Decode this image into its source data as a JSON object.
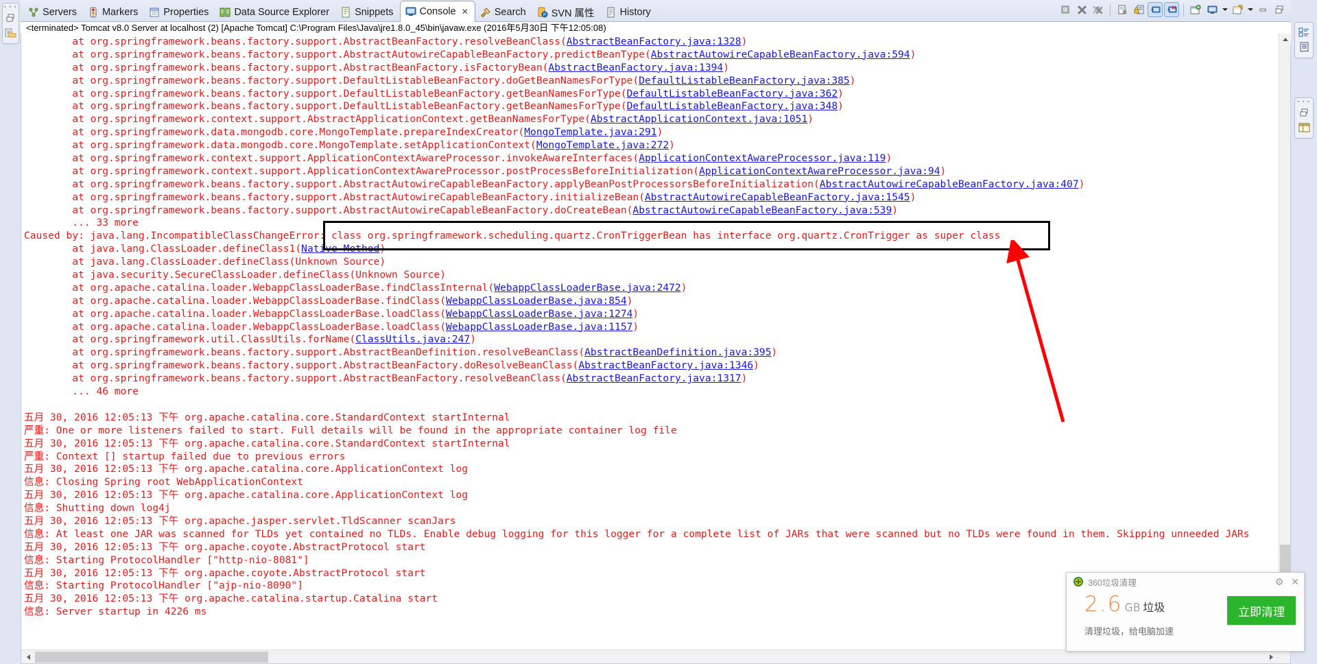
{
  "window": {
    "console_title": "<terminated> Tomcat v8.0 Server at localhost (2) [Apache Tomcat] C:\\Program Files\\Java\\jre1.8.0_45\\bin\\javaw.exe (2016年5月30日 下午12:05:08)"
  },
  "tabs": [
    {
      "label": "Servers",
      "icon": "servers-icon",
      "active": false
    },
    {
      "label": "Markers",
      "icon": "markers-icon",
      "active": false
    },
    {
      "label": "Properties",
      "icon": "properties-icon",
      "active": false
    },
    {
      "label": "Data Source Explorer",
      "icon": "data-source-explorer-icon",
      "active": false
    },
    {
      "label": "Snippets",
      "icon": "snippets-icon",
      "active": false
    },
    {
      "label": "Console",
      "icon": "console-icon",
      "active": true,
      "close": "✕"
    },
    {
      "label": "Search",
      "icon": "search-icon",
      "active": false
    },
    {
      "label": "SVN 属性",
      "icon": "svn-icon",
      "active": false
    },
    {
      "label": "History",
      "icon": "history-icon",
      "active": false
    }
  ],
  "toolbar": {
    "buttons": [
      {
        "name": "terminate-button",
        "icon": "stop-square-icon",
        "pressed": false
      },
      {
        "name": "remove-launch-button",
        "icon": "x-gray-icon",
        "pressed": false
      },
      {
        "name": "remove-all-terminated-button",
        "icon": "xx-gray-icon",
        "pressed": false
      },
      {
        "name": "clear-console-button",
        "icon": "clear-console-icon",
        "pressed": false
      },
      {
        "name": "scroll-lock-button",
        "icon": "scroll-lock-icon",
        "pressed": false
      },
      {
        "name": "show-console-on-output-button",
        "icon": "console-out-icon",
        "pressed": true
      },
      {
        "name": "show-console-on-error-button",
        "icon": "console-err-icon",
        "pressed": true
      },
      {
        "name": "pin-console-button",
        "icon": "pin-console-icon",
        "pressed": false
      },
      {
        "name": "display-selected-console-button",
        "icon": "display-console-icon",
        "pressed": false
      },
      {
        "name": "open-console-button",
        "icon": "open-console-icon",
        "pressed": false
      },
      {
        "name": "minimize-button",
        "icon": "minimize-icon",
        "pressed": false
      },
      {
        "name": "maximize-button",
        "icon": "maximize-icon",
        "pressed": false
      }
    ]
  },
  "left_rail": {
    "icons": [
      "restore-icon",
      "project-explorer-icon"
    ]
  },
  "right_rail": {
    "group1": [
      "outline-icon",
      "document-outline-icon"
    ],
    "group2": [
      "restore-icon",
      "layout-icon"
    ]
  },
  "console_lines": [
    {
      "indent": 8,
      "segments": [
        {
          "t": "at org.springframework.beans.factory.support.AbstractBeanFactory.resolveBeanClass("
        },
        {
          "t": "AbstractBeanFactory.java:1328",
          "link": true
        },
        {
          "t": ")"
        }
      ]
    },
    {
      "indent": 8,
      "segments": [
        {
          "t": "at org.springframework.beans.factory.support.AbstractAutowireCapableBeanFactory.predictBeanType("
        },
        {
          "t": "AbstractAutowireCapableBeanFactory.java:594",
          "link": true
        },
        {
          "t": ")"
        }
      ]
    },
    {
      "indent": 8,
      "segments": [
        {
          "t": "at org.springframework.beans.factory.support.AbstractBeanFactory.isFactoryBean("
        },
        {
          "t": "AbstractBeanFactory.java:1394",
          "link": true
        },
        {
          "t": ")"
        }
      ]
    },
    {
      "indent": 8,
      "segments": [
        {
          "t": "at org.springframework.beans.factory.support.DefaultListableBeanFactory.doGetBeanNamesForType("
        },
        {
          "t": "DefaultListableBeanFactory.java:385",
          "link": true
        },
        {
          "t": ")"
        }
      ]
    },
    {
      "indent": 8,
      "segments": [
        {
          "t": "at org.springframework.beans.factory.support.DefaultListableBeanFactory.getBeanNamesForType("
        },
        {
          "t": "DefaultListableBeanFactory.java:362",
          "link": true
        },
        {
          "t": ")"
        }
      ]
    },
    {
      "indent": 8,
      "segments": [
        {
          "t": "at org.springframework.beans.factory.support.DefaultListableBeanFactory.getBeanNamesForType("
        },
        {
          "t": "DefaultListableBeanFactory.java:348",
          "link": true
        },
        {
          "t": ")"
        }
      ]
    },
    {
      "indent": 8,
      "segments": [
        {
          "t": "at org.springframework.context.support.AbstractApplicationContext.getBeanNamesForType("
        },
        {
          "t": "AbstractApplicationContext.java:1051",
          "link": true
        },
        {
          "t": ")"
        }
      ]
    },
    {
      "indent": 8,
      "segments": [
        {
          "t": "at org.springframework.data.mongodb.core.MongoTemplate.prepareIndexCreator("
        },
        {
          "t": "MongoTemplate.java:291",
          "link": true
        },
        {
          "t": ")"
        }
      ]
    },
    {
      "indent": 8,
      "segments": [
        {
          "t": "at org.springframework.data.mongodb.core.MongoTemplate.setApplicationContext("
        },
        {
          "t": "MongoTemplate.java:272",
          "link": true
        },
        {
          "t": ")"
        }
      ]
    },
    {
      "indent": 8,
      "segments": [
        {
          "t": "at org.springframework.context.support.ApplicationContextAwareProcessor.invokeAwareInterfaces("
        },
        {
          "t": "ApplicationContextAwareProcessor.java:119",
          "link": true
        },
        {
          "t": ")"
        }
      ]
    },
    {
      "indent": 8,
      "segments": [
        {
          "t": "at org.springframework.context.support.ApplicationContextAwareProcessor.postProcessBeforeInitialization("
        },
        {
          "t": "ApplicationContextAwareProcessor.java:94",
          "link": true
        },
        {
          "t": ")"
        }
      ]
    },
    {
      "indent": 8,
      "segments": [
        {
          "t": "at org.springframework.beans.factory.support.AbstractAutowireCapableBeanFactory.applyBeanPostProcessorsBeforeInitialization("
        },
        {
          "t": "AbstractAutowireCapableBeanFactory.java:407",
          "link": true
        },
        {
          "t": ")"
        }
      ]
    },
    {
      "indent": 8,
      "segments": [
        {
          "t": "at org.springframework.beans.factory.support.AbstractAutowireCapableBeanFactory.initializeBean("
        },
        {
          "t": "AbstractAutowireCapableBeanFactory.java:1545",
          "link": true
        },
        {
          "t": ")"
        }
      ]
    },
    {
      "indent": 8,
      "segments": [
        {
          "t": "at org.springframework.beans.factory.support.AbstractAutowireCapableBeanFactory.doCreateBean("
        },
        {
          "t": "AbstractAutowireCapableBeanFactory.java:539",
          "link": true
        },
        {
          "t": ")"
        }
      ]
    },
    {
      "indent": 8,
      "segments": [
        {
          "t": "... 33 more"
        }
      ]
    },
    {
      "indent": 0,
      "segments": [
        {
          "t": "Caused by: java.lang.IncompatibleClassChangeError: class org.springframework.scheduling.quartz.CronTriggerBean has interface org.quartz.CronTrigger as super class"
        }
      ]
    },
    {
      "indent": 8,
      "segments": [
        {
          "t": "at java.lang.ClassLoader.defineClass1("
        },
        {
          "t": "Native Method",
          "link": true
        },
        {
          "t": ")"
        }
      ]
    },
    {
      "indent": 8,
      "segments": [
        {
          "t": "at java.lang.ClassLoader.defineClass(Unknown Source)"
        }
      ]
    },
    {
      "indent": 8,
      "segments": [
        {
          "t": "at java.security.SecureClassLoader.defineClass(Unknown Source)"
        }
      ]
    },
    {
      "indent": 8,
      "segments": [
        {
          "t": "at org.apache.catalina.loader.WebappClassLoaderBase.findClassInternal("
        },
        {
          "t": "WebappClassLoaderBase.java:2472",
          "link": true
        },
        {
          "t": ")"
        }
      ]
    },
    {
      "indent": 8,
      "segments": [
        {
          "t": "at org.apache.catalina.loader.WebappClassLoaderBase.findClass("
        },
        {
          "t": "WebappClassLoaderBase.java:854",
          "link": true
        },
        {
          "t": ")"
        }
      ]
    },
    {
      "indent": 8,
      "segments": [
        {
          "t": "at org.apache.catalina.loader.WebappClassLoaderBase.loadClass("
        },
        {
          "t": "WebappClassLoaderBase.java:1274",
          "link": true
        },
        {
          "t": ")"
        }
      ]
    },
    {
      "indent": 8,
      "segments": [
        {
          "t": "at org.apache.catalina.loader.WebappClassLoaderBase.loadClass("
        },
        {
          "t": "WebappClassLoaderBase.java:1157",
          "link": true
        },
        {
          "t": ")"
        }
      ]
    },
    {
      "indent": 8,
      "segments": [
        {
          "t": "at org.springframework.util.ClassUtils.forName("
        },
        {
          "t": "ClassUtils.java:247",
          "link": true
        },
        {
          "t": ")"
        }
      ]
    },
    {
      "indent": 8,
      "segments": [
        {
          "t": "at org.springframework.beans.factory.support.AbstractBeanDefinition.resolveBeanClass("
        },
        {
          "t": "AbstractBeanDefinition.java:395",
          "link": true
        },
        {
          "t": ")"
        }
      ]
    },
    {
      "indent": 8,
      "segments": [
        {
          "t": "at org.springframework.beans.factory.support.AbstractBeanFactory.doResolveBeanClass("
        },
        {
          "t": "AbstractBeanFactory.java:1346",
          "link": true
        },
        {
          "t": ")"
        }
      ]
    },
    {
      "indent": 8,
      "segments": [
        {
          "t": "at org.springframework.beans.factory.support.AbstractBeanFactory.resolveBeanClass("
        },
        {
          "t": "AbstractBeanFactory.java:1317",
          "link": true
        },
        {
          "t": ")"
        }
      ]
    },
    {
      "indent": 8,
      "segments": [
        {
          "t": "... 46 more"
        }
      ]
    },
    {
      "indent": 0,
      "segments": [
        {
          "t": ""
        }
      ]
    },
    {
      "indent": 0,
      "segments": [
        {
          "t": "五月 30, 2016 12:05:13 下午 org.apache.catalina.core.StandardContext startInternal"
        }
      ]
    },
    {
      "indent": 0,
      "segments": [
        {
          "t": "严重: One or more listeners failed to start. Full details will be found in the appropriate container log file"
        }
      ]
    },
    {
      "indent": 0,
      "segments": [
        {
          "t": "五月 30, 2016 12:05:13 下午 org.apache.catalina.core.StandardContext startInternal"
        }
      ]
    },
    {
      "indent": 0,
      "segments": [
        {
          "t": "严重: Context [] startup failed due to previous errors"
        }
      ]
    },
    {
      "indent": 0,
      "segments": [
        {
          "t": "五月 30, 2016 12:05:13 下午 org.apache.catalina.core.ApplicationContext log"
        }
      ]
    },
    {
      "indent": 0,
      "segments": [
        {
          "t": "信息: Closing Spring root WebApplicationContext"
        }
      ]
    },
    {
      "indent": 0,
      "segments": [
        {
          "t": "五月 30, 2016 12:05:13 下午 org.apache.catalina.core.ApplicationContext log"
        }
      ]
    },
    {
      "indent": 0,
      "segments": [
        {
          "t": "信息: Shutting down log4j"
        }
      ]
    },
    {
      "indent": 0,
      "segments": [
        {
          "t": "五月 30, 2016 12:05:13 下午 org.apache.jasper.servlet.TldScanner scanJars"
        }
      ]
    },
    {
      "indent": 0,
      "segments": [
        {
          "t": "信息: At least one JAR was scanned for TLDs yet contained no TLDs. Enable debug logging for this logger for a complete list of JARs that were scanned but no TLDs were found in them. Skipping unneeded JARs"
        }
      ]
    },
    {
      "indent": 0,
      "segments": [
        {
          "t": "五月 30, 2016 12:05:13 下午 org.apache.coyote.AbstractProtocol start"
        }
      ]
    },
    {
      "indent": 0,
      "segments": [
        {
          "t": "信息: Starting ProtocolHandler [\"http-nio-8081\"]"
        }
      ]
    },
    {
      "indent": 0,
      "segments": [
        {
          "t": "五月 30, 2016 12:05:13 下午 org.apache.coyote.AbstractProtocol start"
        }
      ]
    },
    {
      "indent": 0,
      "segments": [
        {
          "t": "信息: Starting ProtocolHandler [\"ajp-nio-8090\"]"
        }
      ]
    },
    {
      "indent": 0,
      "segments": [
        {
          "t": "五月 30, 2016 12:05:13 下午 org.apache.catalina.startup.Catalina start"
        }
      ]
    },
    {
      "indent": 0,
      "segments": [
        {
          "t": "信息: Server startup in 4226 ms"
        }
      ]
    }
  ],
  "annotations": {
    "highlight_box": {
      "name": "caused-by-highlight-box",
      "color": "#000000"
    },
    "arrow": {
      "name": "red-arrow-annotation",
      "color": "#ff0000"
    }
  },
  "popup360": {
    "title": "360垃圾清理",
    "size_value": "2.6",
    "size_unit": "GB",
    "size_label": "垃圾",
    "subtitle": "清理垃圾，给电脑加速",
    "button_label": "立即清理",
    "gear_icon": "gear-icon",
    "close_icon": "close-icon",
    "accent_color": "#2cb42c",
    "number_color": "#f0854a"
  },
  "scrollbars": {
    "vertical": {
      "up": "▲",
      "down": "▼"
    },
    "horizontal": {
      "left": "◀",
      "right": "▶"
    }
  }
}
